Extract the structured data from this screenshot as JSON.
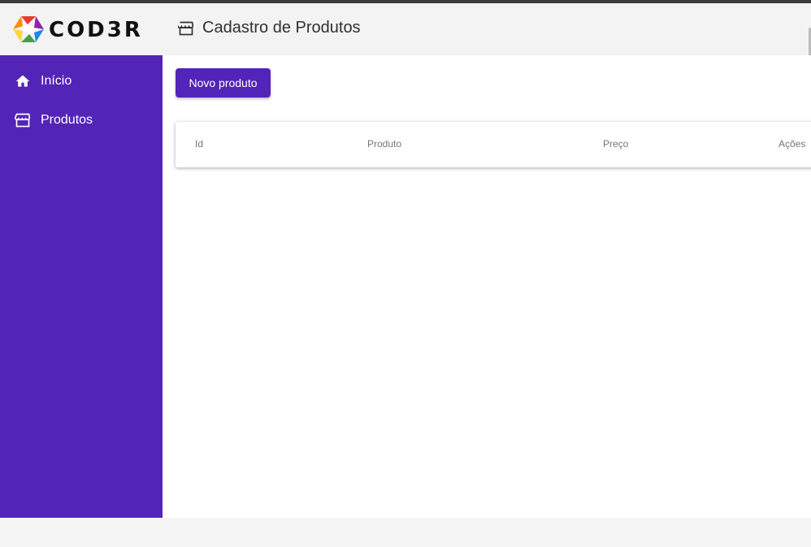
{
  "brand": {
    "logo_text": "COD3R"
  },
  "header": {
    "title": "Cadastro de Produtos",
    "icon": "storefront-icon"
  },
  "sidebar": {
    "items": [
      {
        "label": "Início",
        "icon": "home-icon"
      },
      {
        "label": "Produtos",
        "icon": "storefront-icon"
      }
    ]
  },
  "main": {
    "new_button_label": "Novo produto",
    "table": {
      "columns": [
        "Id",
        "Produto",
        "Preço",
        "Ações"
      ],
      "rows": []
    }
  },
  "colors": {
    "primary": "#5324b8",
    "header_bg": "#f3f3f3",
    "text_dark": "#303030"
  }
}
